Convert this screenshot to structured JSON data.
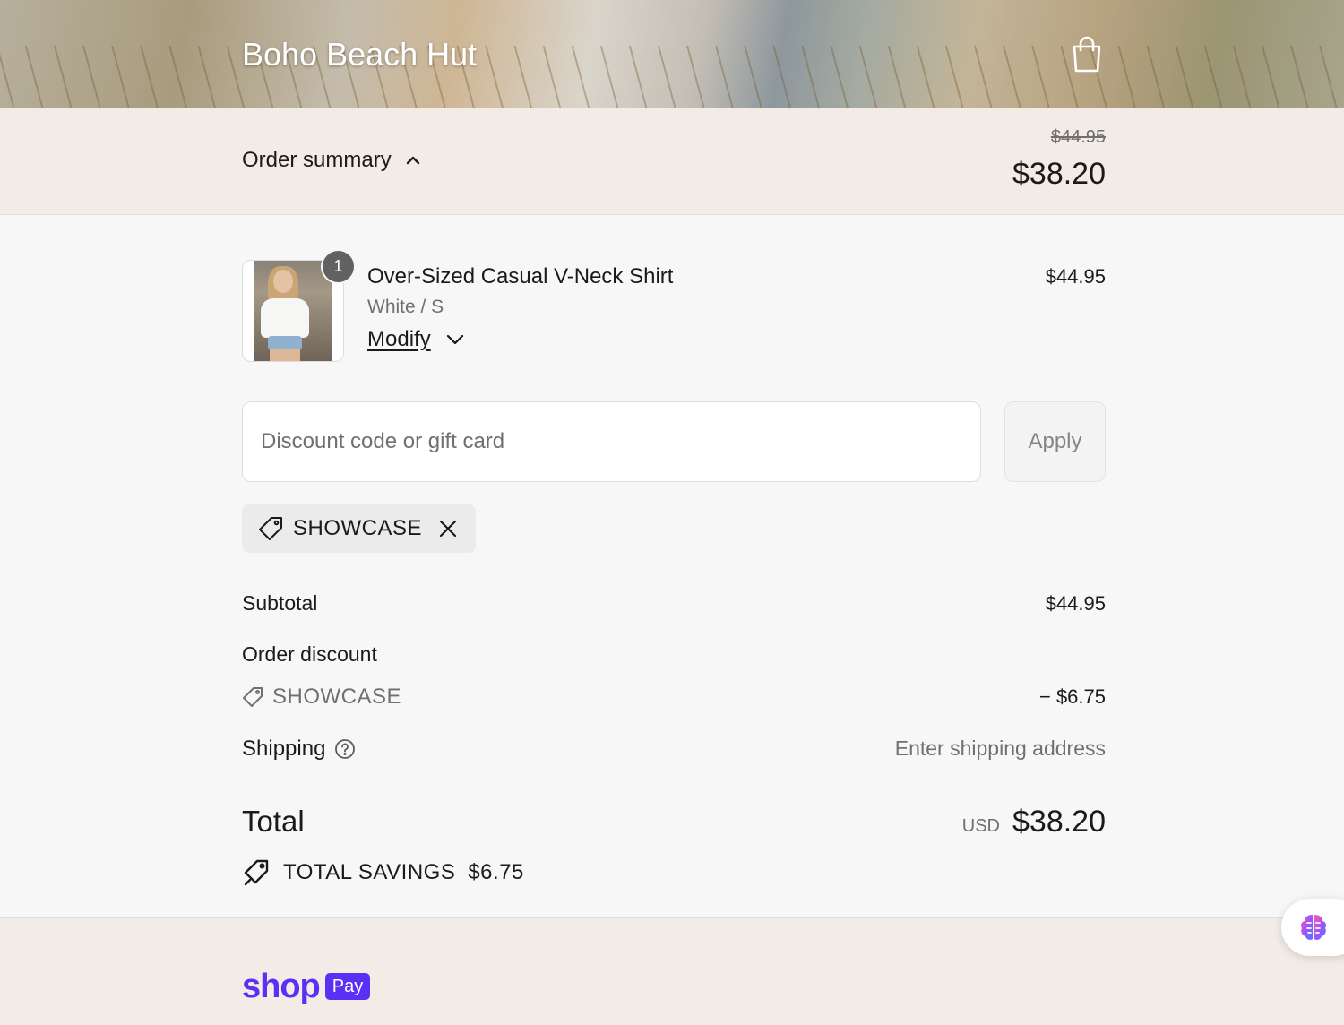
{
  "header": {
    "store_name": "Boho Beach Hut",
    "cart_icon": "shopping-bag-icon"
  },
  "summary": {
    "toggle_label": "Order summary",
    "toggle_icon": "chevron-up-icon",
    "original_total": "$44.95",
    "current_total": "$38.20"
  },
  "line_item": {
    "quantity": "1",
    "name": "Over-Sized Casual V-Neck Shirt",
    "variant": "White / S",
    "modify_label": "Modify",
    "modify_icon": "chevron-down-icon",
    "price": "$44.95"
  },
  "discount": {
    "placeholder": "Discount code or gift card",
    "apply_label": "Apply",
    "applied_code": "SHOWCASE"
  },
  "totals": {
    "subtotal_label": "Subtotal",
    "subtotal_value": "$44.95",
    "order_discount_label": "Order discount",
    "order_discount_code": "SHOWCASE",
    "order_discount_value": "− $6.75",
    "shipping_label": "Shipping",
    "shipping_value": "Enter shipping address",
    "total_label": "Total",
    "total_currency": "USD",
    "total_value": "$38.20",
    "savings_label": "TOTAL SAVINGS",
    "savings_value": "$6.75"
  },
  "footer": {
    "shop_word": "shop",
    "pay_word": "Pay"
  },
  "colors": {
    "summary_bg": "#f3ebe6",
    "page_bg": "#f7f7f7",
    "shop_pay_purple": "#5a31f4",
    "muted_text": "#707070"
  }
}
